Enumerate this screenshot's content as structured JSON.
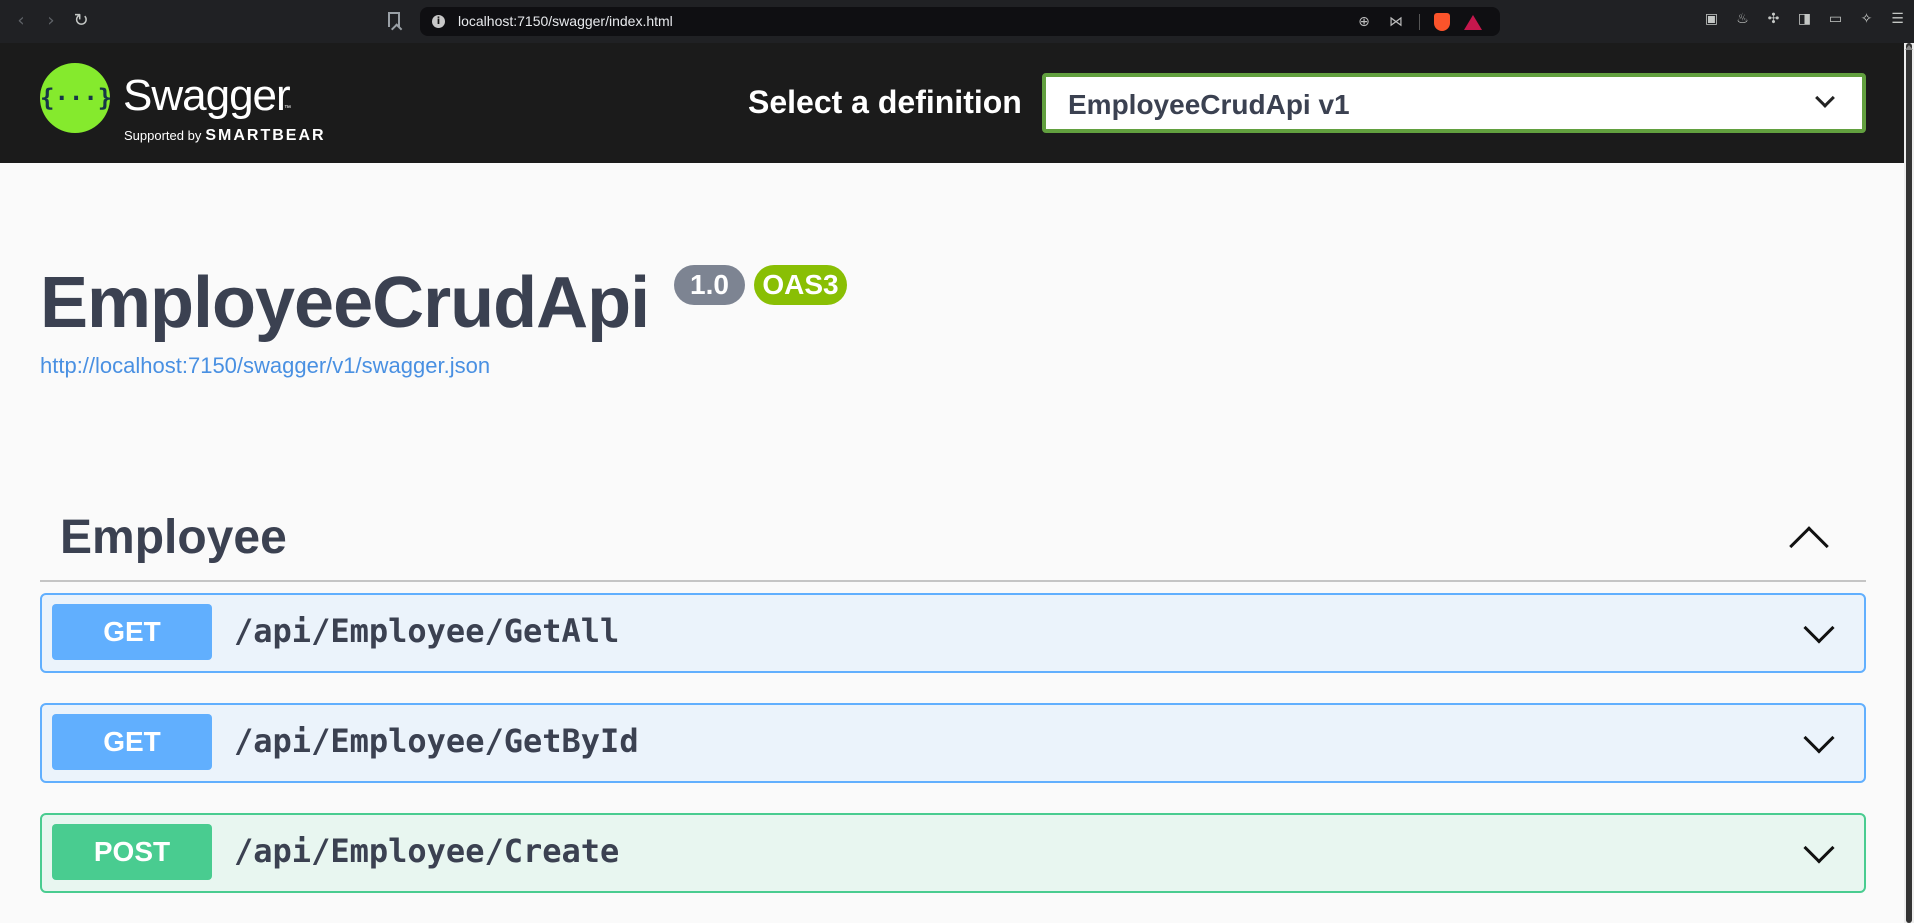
{
  "browser": {
    "back": "‹",
    "forward": "›",
    "reload": "↻",
    "url": "localhost:7150/swagger/index.html",
    "info_icon": "i",
    "zoom_icon": "⊕",
    "share_icon": "⋈",
    "ext_icons": [
      "▣",
      "♨",
      "✣",
      "◨",
      "▭",
      "✧",
      "☰"
    ]
  },
  "topbar": {
    "logo_symbol": "{···}",
    "logo_title": "Swagger",
    "logo_tm": "™",
    "logo_sub": "Supported by",
    "logo_sub_brand": "SMARTBEAR",
    "definition_label": "Select a definition",
    "definition_value": "EmployeeCrudApi v1"
  },
  "info": {
    "title": "EmployeeCrudApi",
    "version": "1.0",
    "oas": "OAS3",
    "spec_url": "http://localhost:7150/swagger/v1/swagger.json"
  },
  "tag": {
    "name": "Employee"
  },
  "operations": [
    {
      "method": "GET",
      "path": "/api/Employee/GetAll"
    },
    {
      "method": "GET",
      "path": "/api/Employee/GetById"
    },
    {
      "method": "POST",
      "path": "/api/Employee/Create"
    }
  ],
  "colors": {
    "get": "#61affe",
    "post": "#49cc90",
    "logo": "#85ea2d",
    "topbar": "#1b1b1b",
    "title": "#3b4151",
    "link": "#4990e2"
  }
}
